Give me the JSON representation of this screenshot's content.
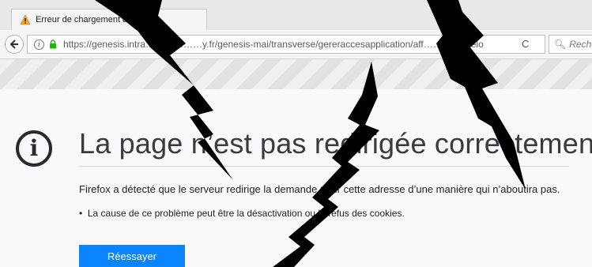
{
  "tab": {
    "title": "Erreur de chargement de l..."
  },
  "nav": {
    "url": "https://genesis.intra………………y.fr/genesis-mai/transverse/gereraccesapplication/aff……………elo",
    "reload_glyph": "C",
    "search_placeholder": "Recher"
  },
  "error": {
    "title": "La page n’est pas redirigée correctement",
    "description": "Firefox a détecté que le serveur redirige la demande pour cette adresse d’une manière qui n’aboutira pas.",
    "bullet": "La cause de ce problème peut être la désactivation ou le refus des cookies.",
    "retry_label": "Réessayer"
  },
  "colors": {
    "accent": "#0a84ff",
    "warning": "#f5a623"
  }
}
